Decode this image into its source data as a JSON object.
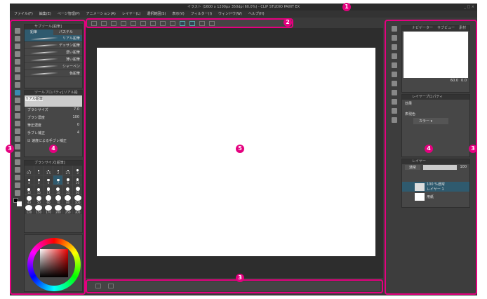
{
  "window": {
    "title": "イラスト (1600 x 1200px 350dpi 60.0%) - CLIP STUDIO PAINT EX",
    "controls": "_ □ ×"
  },
  "menu": [
    "ファイル(F)",
    "編集(E)",
    "ページ管理(P)",
    "アニメーション(A)",
    "レイヤー(L)",
    "選択範囲(S)",
    "表示(V)",
    "フィルター(I)",
    "ウィンドウ(W)",
    "ヘルプ(H)"
  ],
  "subtool": {
    "title": "サブツール[鉛筆]",
    "tabs": [
      "鉛筆",
      "パステル"
    ],
    "items": [
      "リアル鉛筆",
      "デッサン鉛筆",
      "濃い鉛筆",
      "薄い鉛筆",
      "シャーペン",
      "色鉛筆"
    ]
  },
  "toolprop": {
    "title": "ツールプロパティ[リアル鉛筆]",
    "preview": "リアル鉛筆",
    "props": [
      {
        "label": "ブラシサイズ",
        "value": "7.0"
      },
      {
        "label": "ブラシ濃度",
        "value": "100"
      },
      {
        "label": "筆圧濃度",
        "value": "0"
      },
      {
        "label": "手ブレ補正",
        "value": "4"
      }
    ],
    "check": "速度による手ブレ補正"
  },
  "brushsize": {
    "title": "ブラシサイズ[鉛筆]",
    "sizes": [
      "0.7",
      "1",
      "1.5",
      "2",
      "2.5",
      "3",
      "4",
      "5",
      "6",
      "7",
      "8",
      "10",
      "12",
      "15",
      "17",
      "20",
      "25",
      "30",
      "40",
      "50",
      "60",
      "70",
      "80",
      "100",
      "120",
      "150",
      "170",
      "200",
      "250",
      "300"
    ],
    "selected": "7"
  },
  "navigator": {
    "tabs": [
      "ナビゲーター",
      "サブビュー",
      "素材"
    ],
    "zoom": "60.0",
    "angle": "0.0"
  },
  "layerprop": {
    "title": "レイヤープロパティ",
    "effect": "効果",
    "color_label": "表現色",
    "color_value": "カラー"
  },
  "layers": {
    "title": "レイヤー",
    "blend": "通常",
    "opacity": "100",
    "items": [
      {
        "name": "レイヤー 1",
        "meta": "100 %通常"
      },
      {
        "name": "用紙",
        "meta": ""
      }
    ]
  },
  "annotations": [
    "1",
    "2",
    "3",
    "4",
    "5",
    "3",
    "4",
    "3"
  ],
  "colors": {
    "accent": "#e4007f",
    "selection": "#2f5a6e"
  }
}
